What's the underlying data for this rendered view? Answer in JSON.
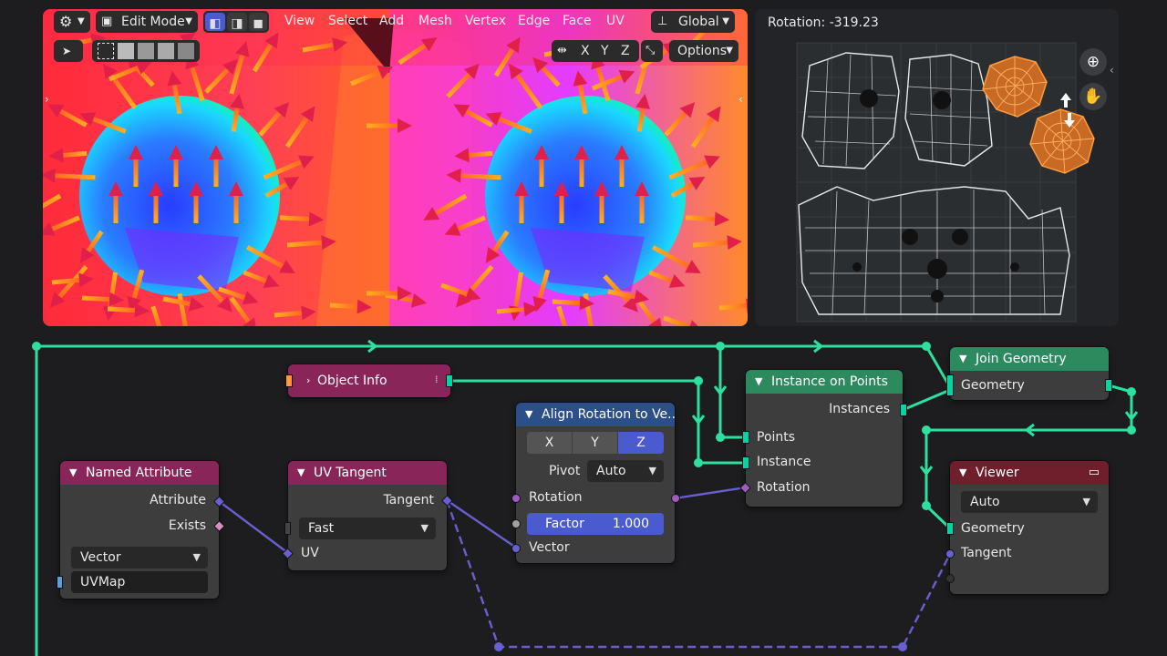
{
  "viewport": {
    "mode_label": "Edit Mode",
    "menu": [
      "View",
      "Select",
      "Add",
      "Mesh",
      "Vertex",
      "Edge",
      "Face",
      "UV"
    ],
    "orientation_label": "Global",
    "axis_x": "X",
    "axis_y": "Y",
    "axis_z": "Z",
    "options_label": "Options"
  },
  "uv_editor": {
    "rotation_label": "Rotation:",
    "rotation_value": "-319.23"
  },
  "nodes": {
    "object_info": {
      "title": "Object Info"
    },
    "named_attribute": {
      "title": "Named Attribute",
      "out_attribute": "Attribute",
      "out_exists": "Exists",
      "type_value": "Vector",
      "name_value": "UVMap"
    },
    "uv_tangent": {
      "title": "UV Tangent",
      "out_tangent": "Tangent",
      "method_value": "Fast",
      "in_uv": "UV"
    },
    "align_rotation": {
      "title": "Align Rotation to Ve...",
      "axis_x": "X",
      "axis_y": "Y",
      "axis_z": "Z",
      "pivot_label": "Pivot",
      "pivot_value": "Auto",
      "in_rotation": "Rotation",
      "factor_label": "Factor",
      "factor_value": "1.000",
      "in_vector": "Vector"
    },
    "instance_on_points": {
      "title": "Instance on Points",
      "out_instances": "Instances",
      "in_points": "Points",
      "in_instance": "Instance",
      "in_rotation": "Rotation"
    },
    "join_geometry": {
      "title": "Join Geometry",
      "in_geometry": "Geometry"
    },
    "viewer": {
      "title": "Viewer",
      "domain_value": "Auto",
      "in_geometry": "Geometry",
      "in_tangent": "Tangent"
    }
  },
  "colors": {
    "geometry_link": "#2ee0a0",
    "vector_link": "#6a5fd0",
    "attribute_header": "#8a2559",
    "vector_header": "#2c4f8a",
    "geometry_header": "#2d8a5f",
    "output_header": "#6e1f2b",
    "accent": "#4a5bd0"
  }
}
